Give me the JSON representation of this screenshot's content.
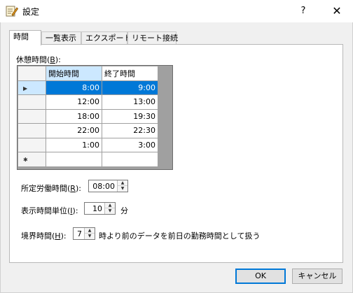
{
  "window": {
    "title": "設定",
    "help_glyph": "?",
    "close_glyph": "✕"
  },
  "tabs": [
    {
      "label": "時間",
      "active": true
    },
    {
      "label": "一覧表示",
      "active": false
    },
    {
      "label": "エクスポート",
      "active": false
    },
    {
      "label": "リモート接続",
      "active": false
    }
  ],
  "breaks": {
    "label_prefix": "休憩時間(",
    "mnemonic": "B",
    "label_suffix": "):",
    "columns": [
      "開始時間",
      "終了時間"
    ],
    "rows": [
      {
        "start": "8:00",
        "end": "9:00",
        "selected": true
      },
      {
        "start": "12:00",
        "end": "13:00"
      },
      {
        "start": "18:00",
        "end": "19:30"
      },
      {
        "start": "22:00",
        "end": "22:30"
      },
      {
        "start": "1:00",
        "end": "3:00"
      }
    ],
    "current_row_glyph": "▶",
    "new_row_glyph": "✱"
  },
  "work_time": {
    "label_prefix": "所定労働時間(",
    "mnemonic": "R",
    "label_suffix": "):",
    "value": "08:00"
  },
  "unit": {
    "label_prefix": "表示時間単位(",
    "mnemonic": "I",
    "label_suffix": "):",
    "value": "10",
    "suffix": "分"
  },
  "boundary": {
    "label_prefix": "境界時間(",
    "mnemonic": "H",
    "label_suffix": "):",
    "value": "7",
    "suffix": "時より前のデータを前日の勤務時間として扱う"
  },
  "buttons": {
    "ok": "OK",
    "cancel": "キャンセル"
  },
  "colors": {
    "accent": "#0078d7",
    "selection_light": "#cce8ff"
  }
}
